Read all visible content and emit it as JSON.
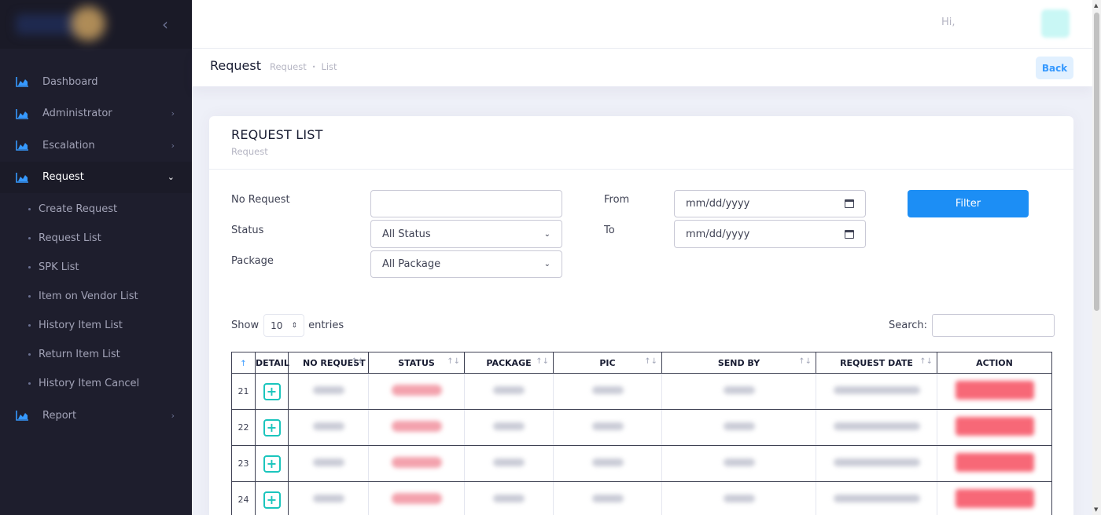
{
  "sidebar": {
    "toggle_icon": "chevron-left-icon",
    "menu": [
      {
        "label": "Dashboard",
        "icon": "chart-area-icon",
        "arrow": ""
      },
      {
        "label": "Administrator",
        "icon": "chart-area-icon",
        "arrow": "›"
      },
      {
        "label": "Escalation",
        "icon": "chart-area-icon",
        "arrow": "›"
      },
      {
        "label": "Request",
        "icon": "chart-area-icon",
        "arrow": "⌄"
      }
    ],
    "submenu": [
      "Create Request",
      "Request List",
      "SPK List",
      "Item on Vendor List",
      "History Item List",
      "Return Item List",
      "History Item Cancel"
    ],
    "report": {
      "label": "Report",
      "icon": "chart-area-icon",
      "arrow": "›"
    }
  },
  "header": {
    "greeting": "Hi,"
  },
  "subheader": {
    "title": "Request",
    "breadcrumb": [
      "Request",
      "List"
    ],
    "back_label": "Back"
  },
  "card": {
    "title": "REQUEST LIST",
    "subtitle": "Request"
  },
  "filters": {
    "no_request_label": "No Request",
    "status_label": "Status",
    "status_value": "All Status",
    "package_label": "Package",
    "package_value": "All Package",
    "from_label": "From",
    "from_placeholder": "mm/dd/yyyy",
    "to_label": "To",
    "to_placeholder": "mm/dd/yyyy",
    "filter_button": "Filter"
  },
  "table_controls": {
    "show_label": "Show",
    "entries_value": "10",
    "entries_label": "entries",
    "search_label": "Search:"
  },
  "table": {
    "columns": [
      "",
      "DETAIL",
      "NO REQUEST",
      "STATUS",
      "PACKAGE",
      "PIC",
      "SEND BY",
      "REQUEST DATE",
      "ACTION"
    ],
    "sort_icon": "↑↓",
    "active_sort_icon": "↑",
    "rows": [
      {
        "no": "21"
      },
      {
        "no": "22"
      },
      {
        "no": "23"
      },
      {
        "no": "24"
      }
    ]
  },
  "colors": {
    "sidebar_bg": "#1e1e2d",
    "primary": "#1c8ef5",
    "teal": "#1bc5bd",
    "danger": "#f64e60"
  }
}
